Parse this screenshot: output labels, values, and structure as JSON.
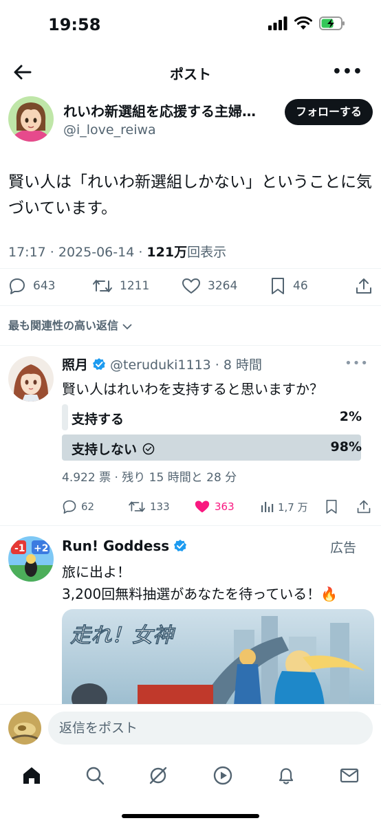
{
  "status_bar": {
    "time": "19:58"
  },
  "nav": {
    "title": "ポスト"
  },
  "post": {
    "author_name": "れいわ新選組を応援する主婦…",
    "author_handle": "@i_love_reiwa",
    "follow_label": "フォローする",
    "text": "賢い人は「れいわ新選組しかない」ということに気づいています。",
    "meta_time": "17:17 · 2025-06-14 · ",
    "meta_views": "121万",
    "meta_views_suffix": "回表示",
    "replies": "643",
    "reposts": "1211",
    "likes": "3264",
    "bookmarks": "46"
  },
  "sort_label": "最も関連性の高い返信",
  "reply": {
    "name": "照月",
    "handle": "@teruduki1113 · 8 時間",
    "text": "賢い人はれいわを支持すると思いますか？",
    "poll": [
      {
        "label": "支持する",
        "pct": "2%",
        "fraction": 0.02,
        "selected": false
      },
      {
        "label": "支持しない",
        "pct": "98%",
        "fraction": 0.98,
        "selected": true
      }
    ],
    "poll_info": "4.922 票 · 残り 15 時間と 28 分",
    "replies": "62",
    "reposts": "133",
    "likes": "363",
    "views": "1,7 万"
  },
  "ad": {
    "name": "Run! Goddess",
    "tag": "広告",
    "line1": "旅に出よ！",
    "line2": "3,200回無料抽選があなたを待っている！🔥",
    "image_text": "走れ！女神",
    "avatar_text_left": "-1",
    "avatar_text_right": "+2"
  },
  "reply_bar": {
    "placeholder": "返信をポスト"
  },
  "colors": {
    "like_pink": "#f91880",
    "verified_blue": "#1d9bf0",
    "poll_fill": "#cfd9de",
    "poll_fill_light": "#e7ecee"
  }
}
